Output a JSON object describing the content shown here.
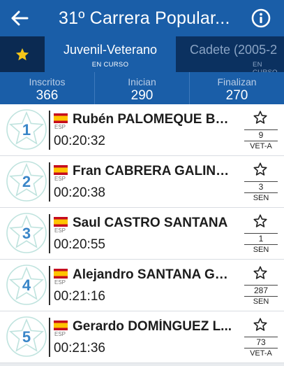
{
  "header": {
    "title": "31º Carrera Popular...",
    "bg_color": "#1a5ea8"
  },
  "tabs": [
    {
      "label": "Juvenil-Veterano",
      "status": "EN CURSO"
    },
    {
      "label": "Cadete (2005-2",
      "status": "EN CURSO"
    }
  ],
  "stats": [
    {
      "label": "Inscritos",
      "value": "366"
    },
    {
      "label": "Inician",
      "value": "290"
    },
    {
      "label": "Finalizan",
      "value": "270"
    }
  ],
  "runners": [
    {
      "position": "1",
      "name": "Rubén PALOMEQUE BA...",
      "country": "ESP",
      "time": "00:20:32",
      "bib": "9",
      "category": "VET-A"
    },
    {
      "position": "2",
      "name": "Fran CABRERA GALINDO",
      "country": "ESP",
      "time": "00:20:38",
      "bib": "3",
      "category": "SEN"
    },
    {
      "position": "3",
      "name": "Saul CASTRO SANTANA",
      "country": "ESP",
      "time": "00:20:55",
      "bib": "1",
      "category": "SEN"
    },
    {
      "position": "4",
      "name": "Alejandro SANTANA GO...",
      "country": "ESP",
      "time": "00:21:16",
      "bib": "287",
      "category": "SEN"
    },
    {
      "position": "5",
      "name": "Gerardo DOMÍNGUEZ L...",
      "country": "ESP",
      "time": "00:21:36",
      "bib": "73",
      "category": "VET-A"
    }
  ],
  "icons": {
    "back": "arrow-left-icon",
    "info": "info-icon",
    "favorites_tab": "star-icon",
    "favorite_row": "star-outline-icon",
    "flag": "spain-flag-icon",
    "position_badge": "star-badge-icon"
  },
  "colors": {
    "accent_star": "#f5c518",
    "badge_outline": "#bfe3de",
    "position_number": "#3a86c8"
  }
}
